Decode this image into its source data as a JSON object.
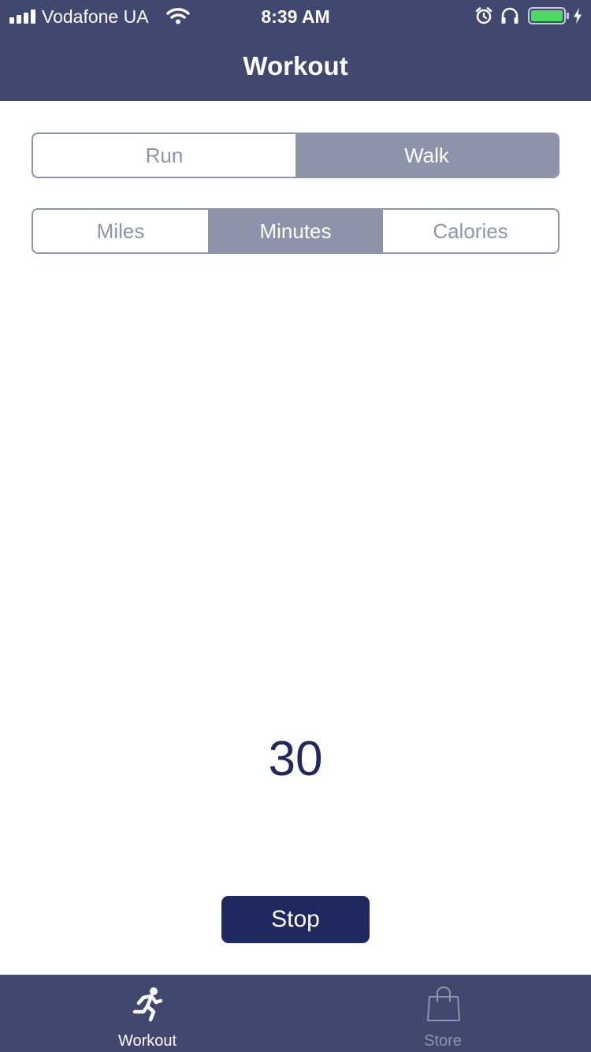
{
  "status_bar": {
    "carrier": "Vodafone UA",
    "time": "8:39 AM",
    "icons": [
      "signal-icon",
      "wifi-icon",
      "alarm-icon",
      "headphones-icon",
      "battery-icon",
      "charging-bolt-icon"
    ],
    "battery_level": 1.0,
    "battery_color": "#4cd964"
  },
  "nav": {
    "title": "Workout"
  },
  "activity_selector": {
    "options": [
      "Run",
      "Walk"
    ],
    "selected": "Walk"
  },
  "metric_selector": {
    "options": [
      "Miles",
      "Minutes",
      "Calories"
    ],
    "selected": "Minutes"
  },
  "counter": {
    "value": "30"
  },
  "stop_button": {
    "label": "Stop"
  },
  "tab_bar": {
    "items": [
      {
        "label": "Workout",
        "icon": "running-person-icon",
        "selected": true
      },
      {
        "label": "Store",
        "icon": "shopping-bag-icon",
        "selected": false
      }
    ]
  },
  "colors": {
    "header_background": "#404870",
    "segment_accent": "#8c94ab",
    "primary_dark": "#1f2960",
    "background": "#ffffff"
  }
}
